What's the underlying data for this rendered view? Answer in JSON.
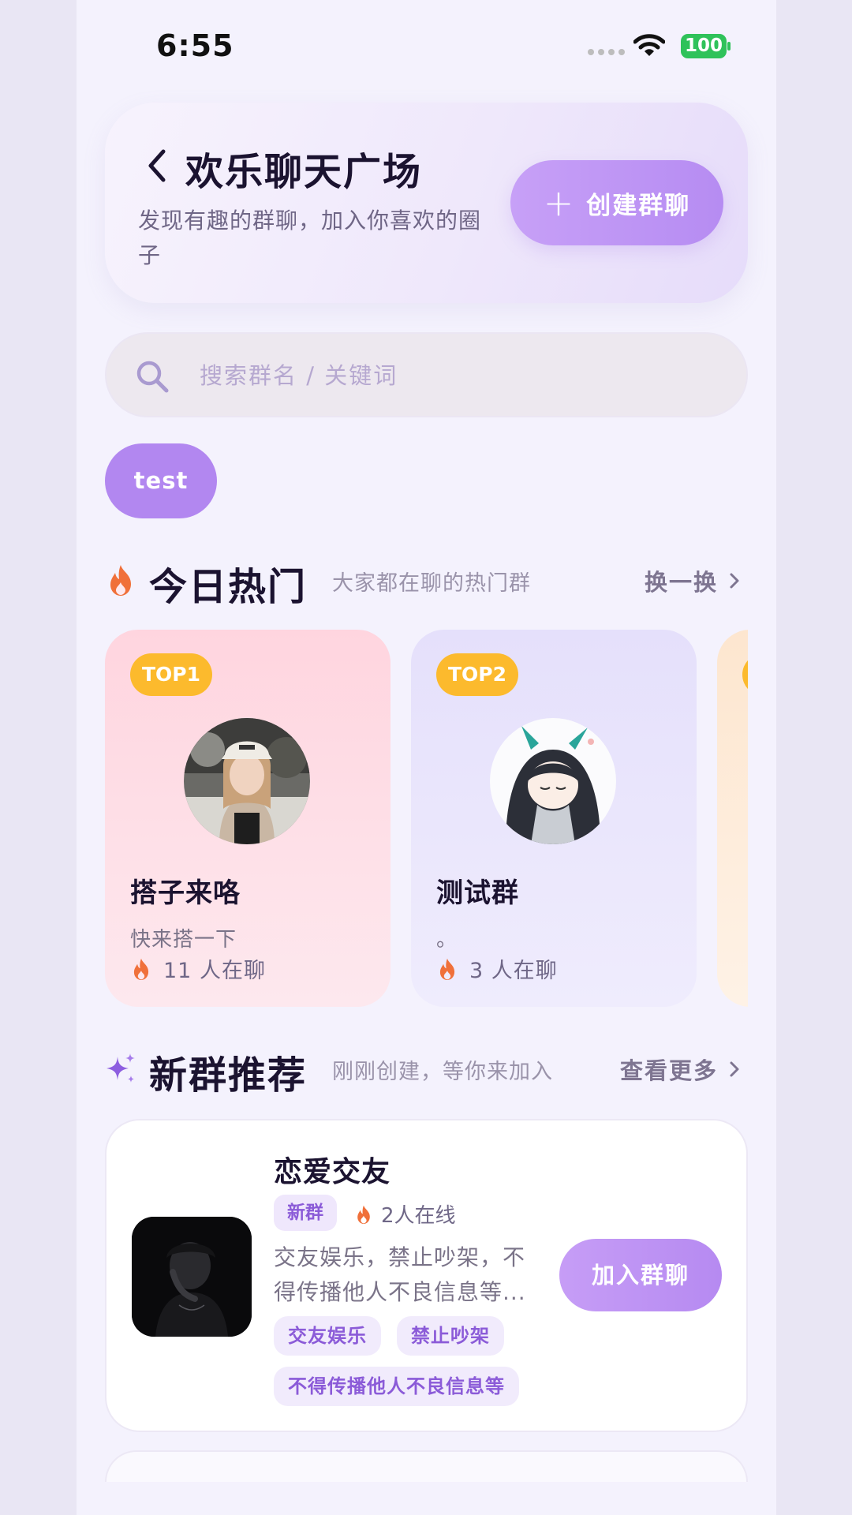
{
  "status_bar": {
    "time": "6:55",
    "battery": "100"
  },
  "header": {
    "title": "欢乐聊天广场",
    "subtitle": "发现有趣的群聊，加入你喜欢的圈子",
    "create_button": "创建群聊",
    "icons": {
      "back": "chevron-left-icon",
      "create": "plus-icon"
    }
  },
  "search": {
    "placeholder": "搜索群名 / 关键词",
    "value": "",
    "icon": "search-icon"
  },
  "filter_chips": [
    {
      "label": "test",
      "selected": true
    }
  ],
  "hot_section": {
    "title": "今日热门",
    "subtitle": "大家都在聊的热门群",
    "action": "换一换",
    "icon": "flame-icon",
    "cards": [
      {
        "rank": "TOP1",
        "name": "搭子来咯",
        "desc": "快来搭一下",
        "count": "11 人在聊"
      },
      {
        "rank": "TOP2",
        "name": "测试群",
        "desc": "。",
        "count": "3 人在聊"
      },
      {
        "rank": "",
        "name": "",
        "desc": "",
        "count": ""
      }
    ]
  },
  "new_section": {
    "title": "新群推荐",
    "subtitle": "刚刚创建，等你来加入",
    "action": "查看更多",
    "icon": "sparkle-icon",
    "groups": [
      {
        "name": "恋爱交友",
        "badge": "新群",
        "online": "2人在线",
        "desc_line1": "交友娱乐，禁止吵架，不",
        "desc_line2": "得传播他人不良信息等...",
        "join_button": "加入群聊",
        "tags": [
          "交友娱乐",
          "禁止吵架",
          "不得传播他人不良信息等"
        ]
      }
    ]
  },
  "colors": {
    "accent": "#b287f0",
    "top_badge": "#fcba2d",
    "flame": "#f0703a",
    "battery": "#2fc25a"
  }
}
